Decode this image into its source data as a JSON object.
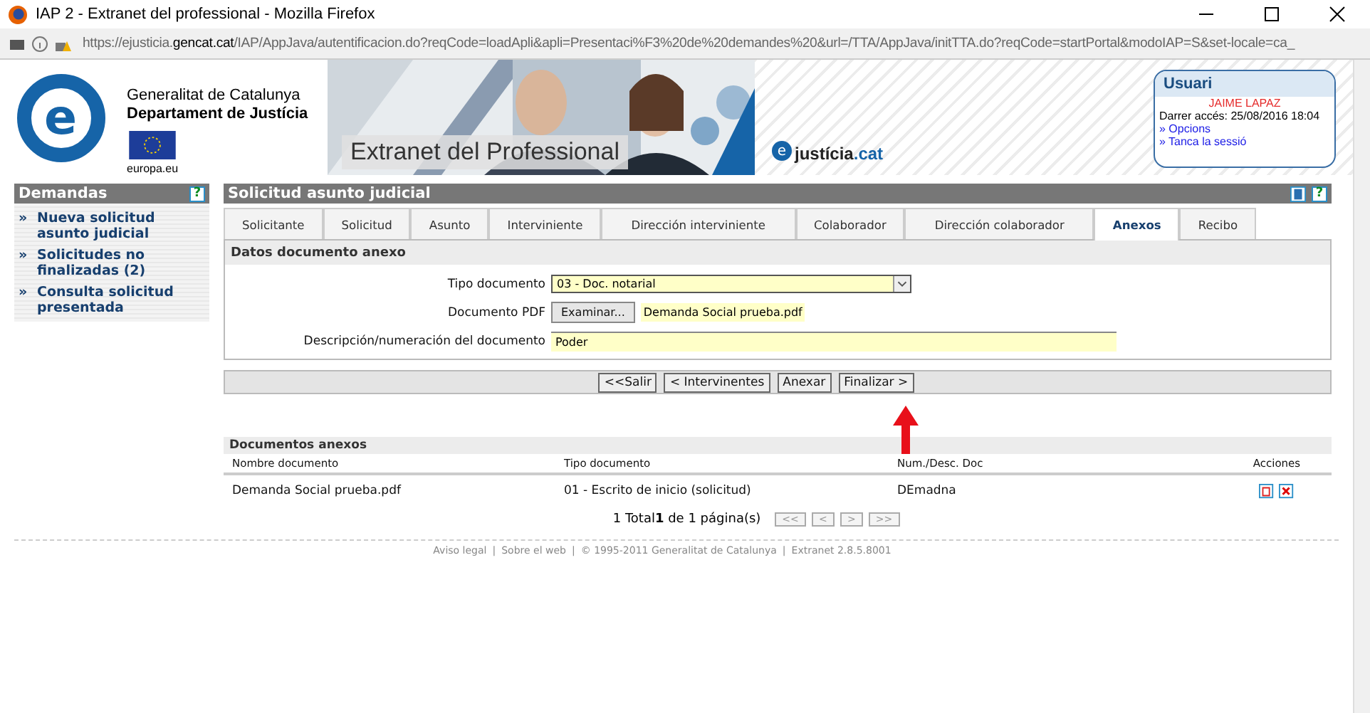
{
  "browser": {
    "title": "IAP 2 - Extranet del professional - Mozilla Firefox",
    "url_prefix": "https://ejusticia.",
    "url_domain": "gencat.cat",
    "url_rest": "/IAP/AppJava/autentificacion.do?reqCode=loadApli&apli=Presentaci%F3%20de%20demandes%20&url=/TTA/AppJava/initTTA.do?reqCode=startPortal&modoIAP=S&set-locale=ca_"
  },
  "banner": {
    "logo_letter": "e",
    "gov_line1": "Generalitat de Catalunya",
    "gov_line2": "Departament de Justícia",
    "eu_label": "europa.eu",
    "title": "Extranet del Professional",
    "brand_letter": "e",
    "brand_name": "justícia",
    "brand_suffix": ".cat"
  },
  "user_box": {
    "title": "Usuari",
    "name": "JAIME LAPAZ",
    "last_access": "Darrer accés: 25/08/2016 18:04",
    "links": [
      "» Opcions",
      "» Tanca la sessió"
    ]
  },
  "sidebar": {
    "title": "Demandas",
    "help": "?",
    "items": [
      {
        "bullet": "»",
        "label": "Nueva solicitud asunto judicial"
      },
      {
        "bullet": "»",
        "label": "Solicitudes no finalizadas (2)"
      },
      {
        "bullet": "»",
        "label": "Consulta solicitud presentada"
      }
    ]
  },
  "main": {
    "title": "Solicitud asunto judicial",
    "help": "?",
    "tabs": [
      {
        "label": "Solicitante",
        "selected": false
      },
      {
        "label": "Solicitud",
        "selected": false
      },
      {
        "label": "Asunto",
        "selected": false
      },
      {
        "label": "Interviniente",
        "selected": false
      },
      {
        "label": "Dirección interviniente",
        "selected": false
      },
      {
        "label": "Colaborador",
        "selected": false
      },
      {
        "label": "Dirección colaborador",
        "selected": false
      },
      {
        "label": "Anexos",
        "selected": true
      },
      {
        "label": "Recibo",
        "selected": false
      }
    ],
    "section_title": "Datos documento anexo",
    "fields": [
      {
        "kind": "select",
        "label": "Tipo documento",
        "value": "03 - Doc. notarial"
      },
      {
        "kind": "file",
        "label": "Documento PDF",
        "button": "Examinar...",
        "value": "Demanda Social prueba.pdf"
      },
      {
        "kind": "text",
        "label": "Descripción/numeración del documento",
        "value": "Poder"
      }
    ],
    "buttons": [
      "<<Salir",
      "< Intervinentes",
      "Anexar",
      "Finalizar >"
    ],
    "annexes": {
      "title": "Documentos anexos",
      "columns": [
        "Nombre documento",
        "Tipo documento",
        "Num./Desc. Doc",
        "Acciones"
      ],
      "rows": [
        {
          "name": "Demanda Social prueba.pdf",
          "type": "01 - Escrito de inicio (solicitud)",
          "desc": "DEmadna"
        }
      ]
    },
    "pagination": {
      "summary": "1 Total**1** de 1 página(s)",
      "buttons": [
        "<<",
        "<",
        ">",
        ">>"
      ]
    }
  },
  "footer": [
    {
      "text": "Aviso legal",
      "separator": "|"
    },
    {
      "text": "Sobre el web",
      "separator": "|"
    },
    {
      "text": "© 1995-2011 Generalitat de Catalunya",
      "separator": "|"
    },
    {
      "text": "Extranet 2.8.5.8001"
    }
  ]
}
